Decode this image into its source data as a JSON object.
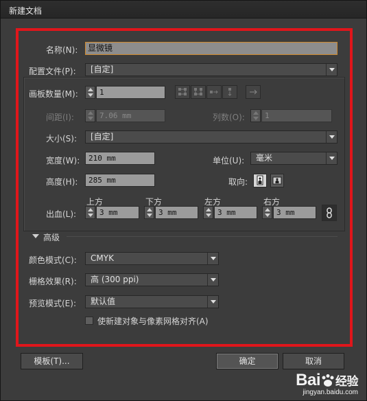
{
  "window": {
    "title": "新建文档"
  },
  "name": {
    "label": "名称(N):",
    "value": "显微镜"
  },
  "profile": {
    "label": "配置文件(P):",
    "value": "[自定]"
  },
  "artboards": {
    "label": "画板数量(M):",
    "value": "1"
  },
  "spacing": {
    "label": "间距(I):",
    "value": "7.06 mm"
  },
  "columns": {
    "label": "列数(O):",
    "value": "1"
  },
  "size": {
    "label": "大小(S):",
    "value": "[自定]"
  },
  "width": {
    "label": "宽度(W):",
    "value": "210 mm"
  },
  "units": {
    "label": "单位(U):",
    "value": "毫米"
  },
  "height": {
    "label": "高度(H):",
    "value": "285 mm"
  },
  "orientation": {
    "label": "取向:"
  },
  "bleed": {
    "label": "出血(L):",
    "top_label": "上方",
    "top_value": "3 mm",
    "bottom_label": "下方",
    "bottom_value": "3 mm",
    "left_label": "左方",
    "left_value": "3 mm",
    "right_label": "右方",
    "right_value": "3 mm"
  },
  "advanced": {
    "label": "高级",
    "color_mode": {
      "label": "颜色模式(C):",
      "value": "CMYK"
    },
    "raster": {
      "label": "栅格效果(R):",
      "value": "高 (300 ppi)"
    },
    "preview": {
      "label": "预览模式(E):",
      "value": "默认值"
    },
    "align_pixel": {
      "label": "使新建对象与像素网格对齐(A)"
    }
  },
  "buttons": {
    "templates": "模板(T)...",
    "ok": "确定",
    "cancel": "取消"
  },
  "watermark": {
    "brand": "Bai",
    "brand_cn": "经验",
    "url": "jingyan.baidu.com"
  },
  "colors": {
    "highlight": "#e0161b",
    "name_focus": "#d08a2d"
  },
  "icons": [
    "grid-by-row-icon",
    "grid-by-column-icon",
    "arrange-by-row-icon",
    "arrange-by-column-icon",
    "layout-rtl-icon",
    "portrait-icon",
    "landscape-icon",
    "link-icon",
    "disclosure-triangle-icon",
    "up-arrow-icon",
    "down-arrow-icon"
  ]
}
